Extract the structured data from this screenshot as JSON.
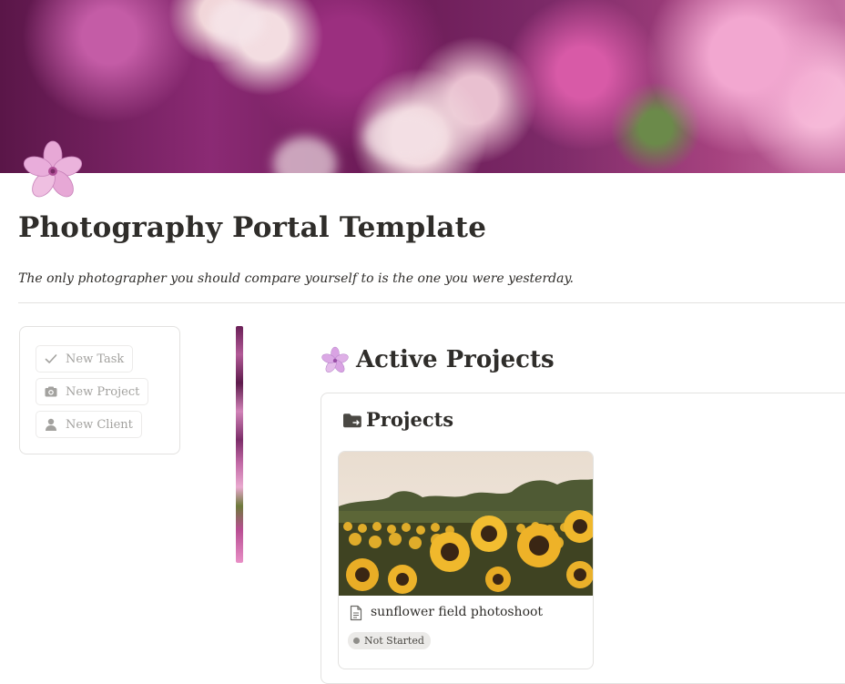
{
  "page": {
    "title": "Photography Portal Template",
    "quote": "The only photographer you should compare yourself to is the one you were yesterday."
  },
  "buttons": [
    {
      "label": "New Task",
      "icon": "check-icon"
    },
    {
      "label": "New Project",
      "icon": "camera-icon"
    },
    {
      "label": "New Client",
      "icon": "person-icon"
    }
  ],
  "active_projects": {
    "heading": "Active Projects",
    "icon": "flower-icon"
  },
  "projects": {
    "heading": "Projects",
    "icon": "folder-icon",
    "cards": [
      {
        "title": "sunflower field photoshoot",
        "status": "Not Started",
        "cover": "sunflower-field-image"
      }
    ]
  },
  "colors": {
    "accent": "#c46ea1",
    "text": "#37352f",
    "muted": "#a3a29f",
    "badge_bg": "#ebeae8",
    "border": "#e3e2e0"
  }
}
